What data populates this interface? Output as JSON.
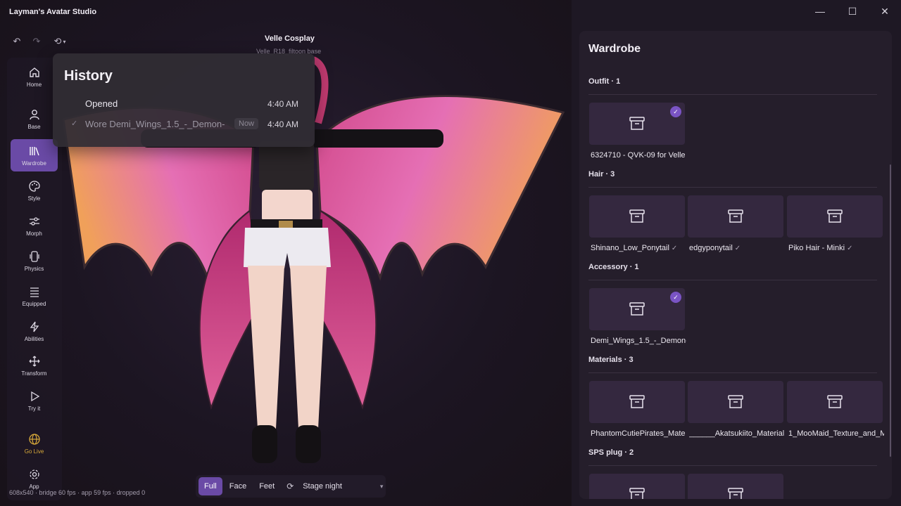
{
  "app": {
    "title": "Layman's Avatar Studio"
  },
  "window_controls": {
    "minimize": "—",
    "maximize": "☐",
    "close": "✕"
  },
  "viewport": {
    "avatar_name": "Velle Cosplay",
    "avatar_base": "Velle_R18_filtoon base",
    "perf": "608x540 · bridge 60 fps · app 59 fps · dropped 0"
  },
  "sidebar": {
    "items": [
      {
        "label": "Home",
        "icon": "home-icon"
      },
      {
        "label": "Base",
        "icon": "person-icon"
      },
      {
        "label": "Wardrobe",
        "icon": "library-icon",
        "active": true
      },
      {
        "label": "Style",
        "icon": "palette-icon"
      },
      {
        "label": "Morph",
        "icon": "sliders-icon"
      },
      {
        "label": "Physics",
        "icon": "phone-icon"
      },
      {
        "label": "Equipped",
        "icon": "list-icon"
      },
      {
        "label": "Abilities",
        "icon": "bolt-icon"
      },
      {
        "label": "Transform",
        "icon": "move-icon"
      },
      {
        "label": "Try it",
        "icon": "play-icon"
      },
      {
        "label": "Go Live",
        "icon": "globe-icon"
      },
      {
        "label": "App",
        "icon": "gear-icon"
      }
    ]
  },
  "history": {
    "title": "History",
    "rows": [
      {
        "label": "Opened",
        "time": "4:40 AM"
      },
      {
        "label": "Wore Demi_Wings_1.5_-_Demon-",
        "badge": "Now",
        "time": "4:40 AM"
      }
    ]
  },
  "bottom_bar": {
    "views": [
      "Full",
      "Face",
      "Feet"
    ],
    "active_view": "Full",
    "stage": "Stage night"
  },
  "wardrobe": {
    "title": "Wardrobe",
    "sections": [
      {
        "title": "Outfit · 1",
        "items": [
          {
            "name": "6324710 - QVK-09 for Velle",
            "worn": true
          }
        ]
      },
      {
        "title": "Hair · 3",
        "items": [
          {
            "name": "Shinano_Low_Ponytail",
            "tick": "✓"
          },
          {
            "name": "edgyponytail",
            "tick": "✓"
          },
          {
            "name": "Piko Hair - Minki",
            "tick": "✓"
          }
        ]
      },
      {
        "title": "Accessory · 1",
        "items": [
          {
            "name": "Demi_Wings_1.5_-_Demon-",
            "worn": true
          }
        ]
      },
      {
        "title": "Materials · 3",
        "items": [
          {
            "name": "PhantomCutiePirates_Mate"
          },
          {
            "name": "______Akatsukiito_Material"
          },
          {
            "name": "1_MooMaid_Texture_and_M"
          }
        ]
      },
      {
        "title": "SPS plug · 2",
        "items": [
          {
            "name": ""
          },
          {
            "name": ""
          }
        ]
      }
    ]
  },
  "colors": {
    "accent": "#6a4aa6",
    "badge": "#7a54c4",
    "live": "#d8a93a"
  }
}
